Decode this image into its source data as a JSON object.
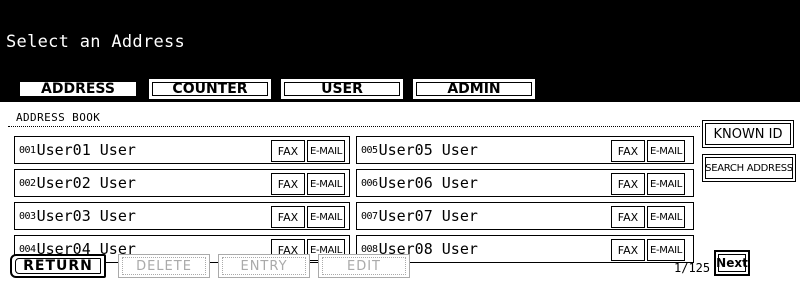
{
  "header": {
    "title": "Select an Address"
  },
  "tabs": [
    {
      "label": "ADDRESS",
      "active": true
    },
    {
      "label": "COUNTER",
      "active": false
    },
    {
      "label": "USER",
      "active": false
    },
    {
      "label": "ADMIN",
      "active": false
    }
  ],
  "address_book": {
    "label": "ADDRESS BOOK",
    "fax_label": "FAX",
    "email_label": "E-MAIL",
    "entries": [
      {
        "number": "001",
        "name": "User01 User"
      },
      {
        "number": "002",
        "name": "User02 User"
      },
      {
        "number": "003",
        "name": "User03 User"
      },
      {
        "number": "004",
        "name": "User04 User"
      },
      {
        "number": "005",
        "name": "User05 User"
      },
      {
        "number": "006",
        "name": "User06 User"
      },
      {
        "number": "007",
        "name": "User07 User"
      },
      {
        "number": "008",
        "name": "User08 User"
      }
    ]
  },
  "side": {
    "known_id_label": "KNOWN ID",
    "search_address_label": "SEARCH ADDRESS"
  },
  "footer": {
    "return_label": "RETURN",
    "delete_label": "DELETE",
    "entry_label": "ENTRY",
    "edit_label": "EDIT",
    "page_counter": "1/125",
    "next_label": "Next"
  }
}
